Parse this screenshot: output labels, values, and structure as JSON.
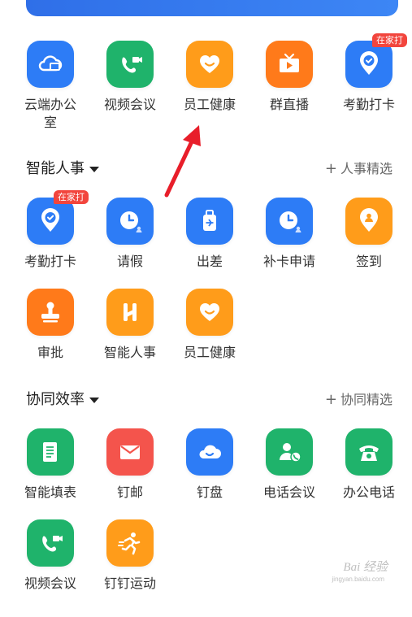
{
  "colors": {
    "blue": "#2d7cf6",
    "green": "#1fb36b",
    "orange": "#ff9c1a",
    "deep_orange": "#ff7a1a",
    "red": "#f4544c",
    "badge": "#f2453d",
    "arrow": "#e81e2a"
  },
  "apps_top": [
    {
      "label": "云端办公室",
      "icon": "cloud-desktop-icon"
    },
    {
      "label": "视频会议",
      "icon": "video-call-icon"
    },
    {
      "label": "员工健康",
      "icon": "heart-smile-icon"
    },
    {
      "label": "群直播",
      "icon": "tv-play-icon"
    },
    {
      "label": "考勤打卡",
      "icon": "location-check-icon",
      "badge": "在家打"
    }
  ],
  "sections": [
    {
      "title": "智能人事",
      "link": "人事精选",
      "rows": [
        [
          {
            "label": "考勤打卡",
            "icon": "location-check-icon",
            "badge": "在家打"
          },
          {
            "label": "请假",
            "icon": "clock-person-icon"
          },
          {
            "label": "出差",
            "icon": "luggage-icon"
          },
          {
            "label": "补卡申请",
            "icon": "clock-person-icon"
          },
          {
            "label": "签到",
            "icon": "location-person-icon"
          }
        ],
        [
          {
            "label": "审批",
            "icon": "stamp-icon"
          },
          {
            "label": "智能人事",
            "icon": "h-logo-icon"
          },
          {
            "label": "员工健康",
            "icon": "heart-smile-icon"
          }
        ]
      ]
    },
    {
      "title": "协同效率",
      "link": "协同精选",
      "rows": [
        [
          {
            "label": "智能填表",
            "icon": "form-scroll-icon"
          },
          {
            "label": "钉邮",
            "icon": "mail-icon"
          },
          {
            "label": "钉盘",
            "icon": "cloud-drive-icon"
          },
          {
            "label": "电话会议",
            "icon": "person-phone-icon"
          },
          {
            "label": "办公电话",
            "icon": "telephone-icon"
          }
        ],
        [
          {
            "label": "视频会议",
            "icon": "video-call-icon"
          },
          {
            "label": "钉钉运动",
            "icon": "runner-icon"
          }
        ]
      ]
    }
  ],
  "watermark": {
    "text": "Bai 经验",
    "sub": "jingyan.baidu.com"
  }
}
